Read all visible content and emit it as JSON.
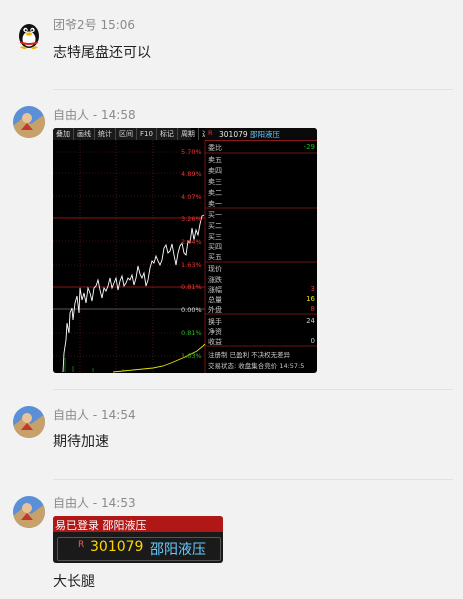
{
  "messages": [
    {
      "sender": "团爷2号",
      "time": "15:06",
      "text": "志特尾盘还可以"
    },
    {
      "sender": "自由人",
      "time": "14:58",
      "text": ""
    },
    {
      "sender": "自由人",
      "time": "14:54",
      "text": "期待加速"
    },
    {
      "sender": "自由人",
      "time": "14:53",
      "text": "大长腿"
    }
  ],
  "chart": {
    "tabs": [
      "叠加",
      "画线",
      "统计",
      "区间",
      "F10",
      "标记",
      "周期",
      "选股"
    ],
    "pct_labels_up": [
      "5.70%",
      "4.89%",
      "4.07%",
      "3.26%",
      "2.44%",
      "1.63%",
      "0.81%"
    ],
    "pct_label_zero": "0.00%",
    "pct_labels_down": [
      "0.81%",
      "1.63%"
    ],
    "stock_code": "301079",
    "stock_name": "邵阳液压",
    "r_mark": "R",
    "quote_rows": [
      "委比",
      "卖五",
      "卖四",
      "卖三",
      "卖二",
      "卖一",
      "买一",
      "买二",
      "买三",
      "买四",
      "买五",
      "现价",
      "涨跌",
      "涨幅",
      "总量",
      "外盘",
      "换手",
      "净资",
      "收益"
    ],
    "quote_vals": [
      "-29",
      "",
      "",
      "",
      "",
      "",
      "",
      "",
      "",
      "",
      "",
      "",
      "",
      "3",
      "16",
      "8",
      "24",
      "",
      "0"
    ],
    "bottom_line1": "注册制 已盈利 不决权无差异",
    "bottom_line2": "交易状态: 收盘集合竞价 14:57:5"
  },
  "banner": {
    "top_text": "易已登录  邵阳液压",
    "r_mark": "R",
    "code": "301079",
    "name": "邵阳液压"
  },
  "colors": {
    "bg": "#f2f2f2",
    "chart_bg": "#000000",
    "up_red": "#e33333",
    "down_green": "#22bb22",
    "price_line": "#ffffff",
    "volume": "#e5e500",
    "banner_red": "#b01818",
    "code_yellow": "#ffd700",
    "name_cyan": "#66ccff"
  }
}
